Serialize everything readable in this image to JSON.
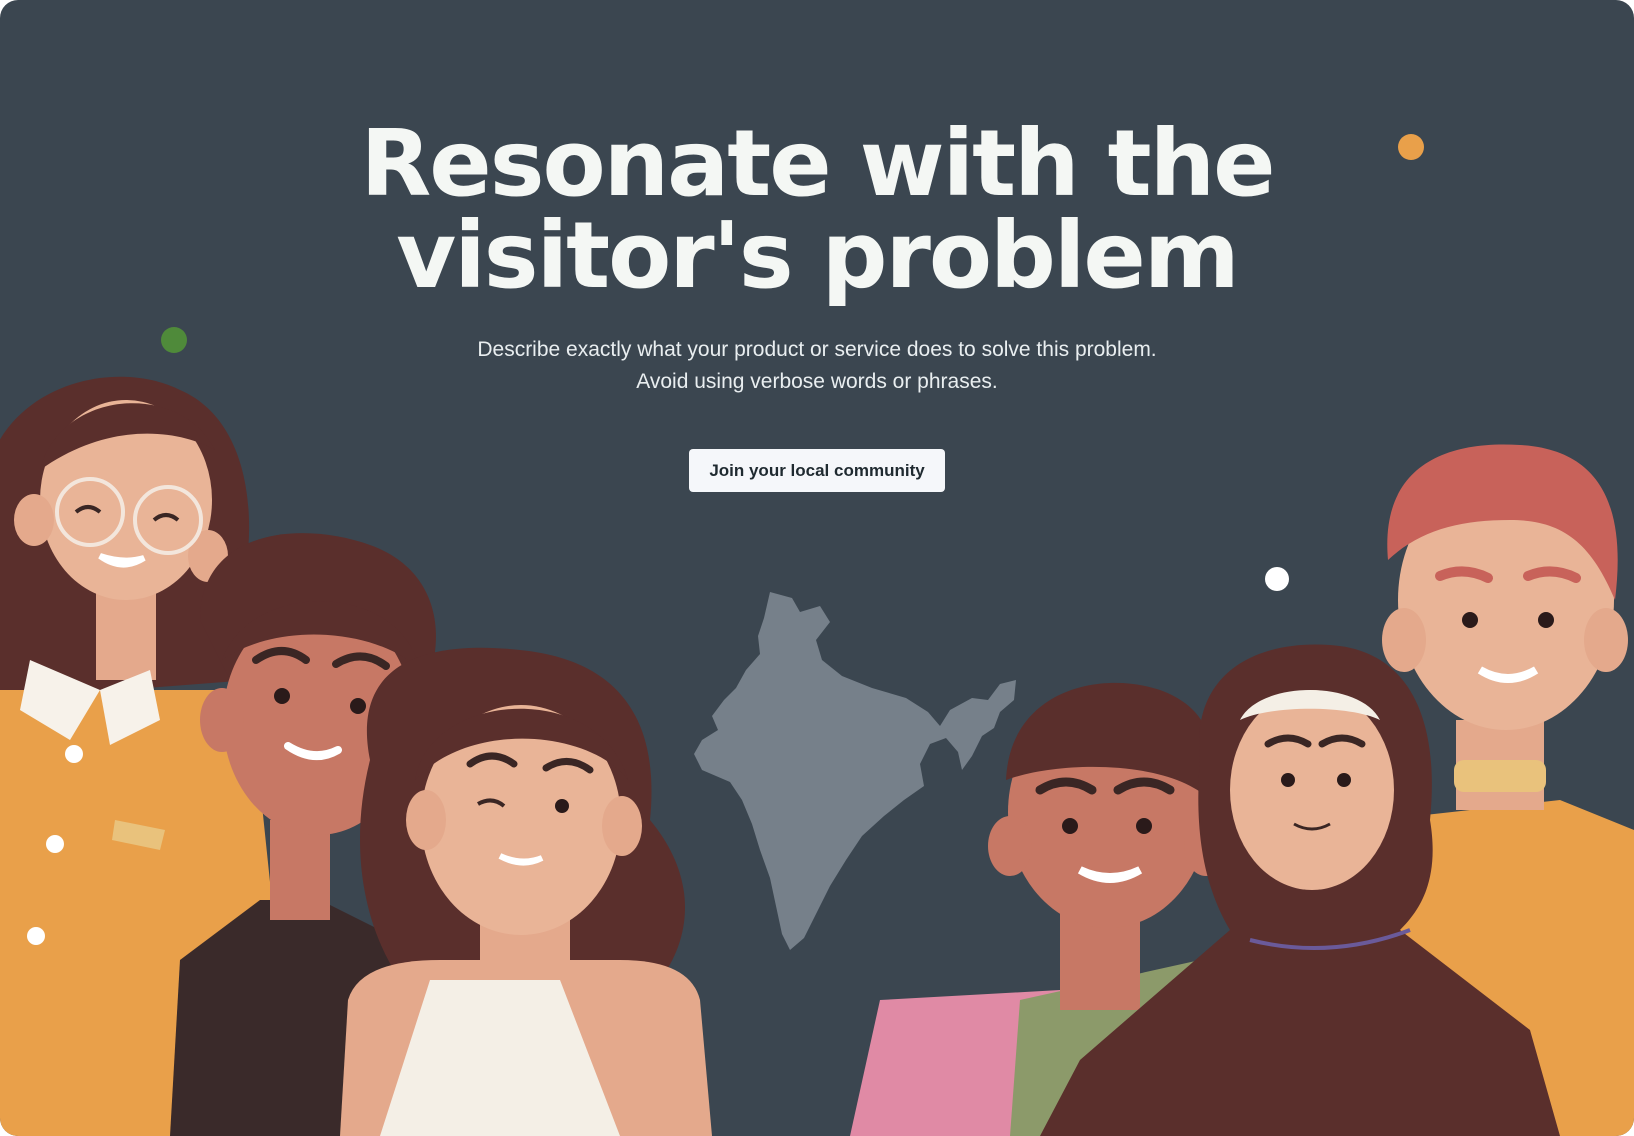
{
  "hero": {
    "title_line1": "Resonate with the",
    "title_line2": "visitor's problem",
    "subtitle_line1": "Describe exactly what your product or service does to solve this problem.",
    "subtitle_line2": "Avoid using verbose words or phrases.",
    "cta_label": "Join your local community"
  },
  "colors": {
    "background": "#3b4650",
    "title": "#f4f7f4",
    "button_bg": "#f5f7fa",
    "accent_orange": "#e9a04a",
    "accent_green": "#4f8a3a",
    "map": "#76808a"
  },
  "illustration": {
    "subject": "group-of-diverse-people",
    "map": "india-map-icon",
    "decorations": [
      "orange-dot",
      "green-dot",
      "white-dot"
    ]
  }
}
